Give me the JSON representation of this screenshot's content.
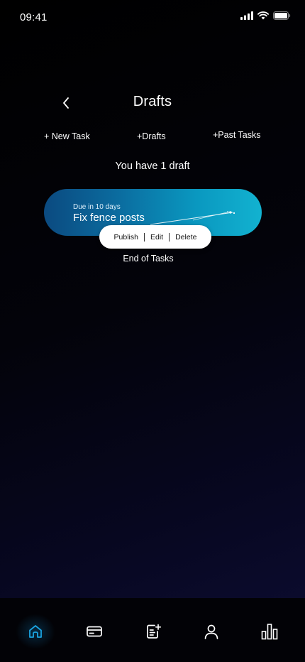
{
  "status_bar": {
    "time": "09:41",
    "icons": [
      "signal-icon",
      "wifi-icon",
      "battery-icon"
    ]
  },
  "header": {
    "title": "Drafts",
    "back_icon": "chevron-left-icon"
  },
  "tabs": [
    {
      "label": "+ New Task"
    },
    {
      "label": "+Drafts"
    },
    {
      "label": "+Past Tasks"
    }
  ],
  "drafts": {
    "summary": "You have 1 draft",
    "items": [
      {
        "due": "Due in 10 days",
        "title": "Fix fence posts"
      }
    ],
    "actions": {
      "publish": "Publish",
      "edit": "Edit",
      "delete": "Delete"
    },
    "end_label": "End of Tasks"
  },
  "bottom_nav": {
    "items": [
      {
        "icon": "home-icon",
        "active": true
      },
      {
        "icon": "card-icon",
        "active": false
      },
      {
        "icon": "note-add-icon",
        "active": false
      },
      {
        "icon": "profile-icon",
        "active": false
      },
      {
        "icon": "bar-chart-icon",
        "active": false
      }
    ]
  },
  "colors": {
    "accent": "#1aa3e0",
    "card_start": "#0b4a80",
    "card_end": "#12b2d0",
    "background": "#000000"
  }
}
